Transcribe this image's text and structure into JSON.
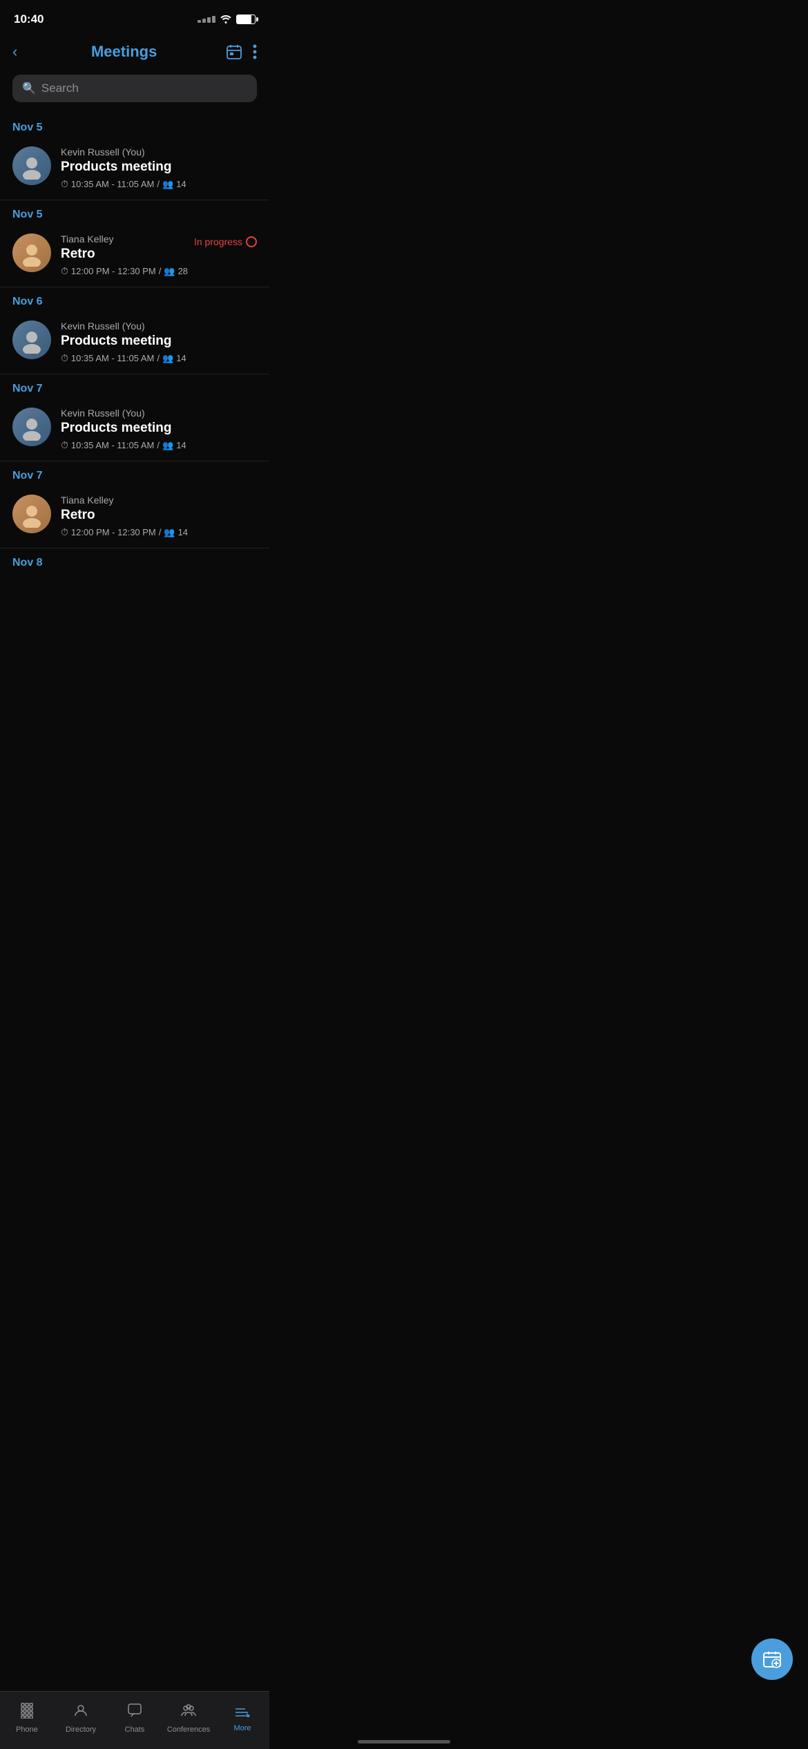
{
  "statusBar": {
    "time": "10:40"
  },
  "header": {
    "title": "Meetings",
    "backLabel": "<",
    "calendarIconLabel": "calendar-icon",
    "moreIconLabel": "more-options-icon"
  },
  "search": {
    "placeholder": "Search"
  },
  "meetings": [
    {
      "id": 1,
      "date": "Nov 5",
      "organizer": "Kevin Russell (You)",
      "title": "Products meeting",
      "time": "10:35 AM - 11:05 AM",
      "participants": "14",
      "inProgress": false,
      "avatarType": "kevin"
    },
    {
      "id": 2,
      "date": "Nov 5",
      "organizer": "Tiana Kelley",
      "title": "Retro",
      "time": "12:00 PM - 12:30 PM",
      "participants": "28",
      "inProgress": true,
      "inProgressLabel": "In progress",
      "avatarType": "tiana"
    },
    {
      "id": 3,
      "date": "Nov 6",
      "organizer": "Kevin Russell (You)",
      "title": "Products meeting",
      "time": "10:35 AM - 11:05 AM",
      "participants": "14",
      "inProgress": false,
      "avatarType": "kevin"
    },
    {
      "id": 4,
      "date": "Nov 7",
      "organizer": "Kevin Russell (You)",
      "title": "Products meeting",
      "time": "10:35 AM - 11:05 AM",
      "participants": "14",
      "inProgress": false,
      "avatarType": "kevin"
    },
    {
      "id": 5,
      "date": "Nov 7",
      "organizer": "Tiana Kelley",
      "title": "Retro",
      "time": "12:00 PM - 12:30 PM",
      "participants": "14",
      "inProgress": false,
      "avatarType": "tiana"
    },
    {
      "id": 6,
      "date": "Nov 8",
      "organizer": "",
      "title": "",
      "time": "",
      "participants": "",
      "inProgress": false,
      "avatarType": "kevin"
    }
  ],
  "bottomNav": {
    "items": [
      {
        "id": "phone",
        "label": "Phone",
        "active": false
      },
      {
        "id": "directory",
        "label": "Directory",
        "active": false
      },
      {
        "id": "chats",
        "label": "Chats",
        "active": false
      },
      {
        "id": "conferences",
        "label": "Conferences",
        "active": false
      },
      {
        "id": "more",
        "label": "More",
        "active": true
      }
    ]
  },
  "fab": {
    "label": "Schedule meeting"
  }
}
